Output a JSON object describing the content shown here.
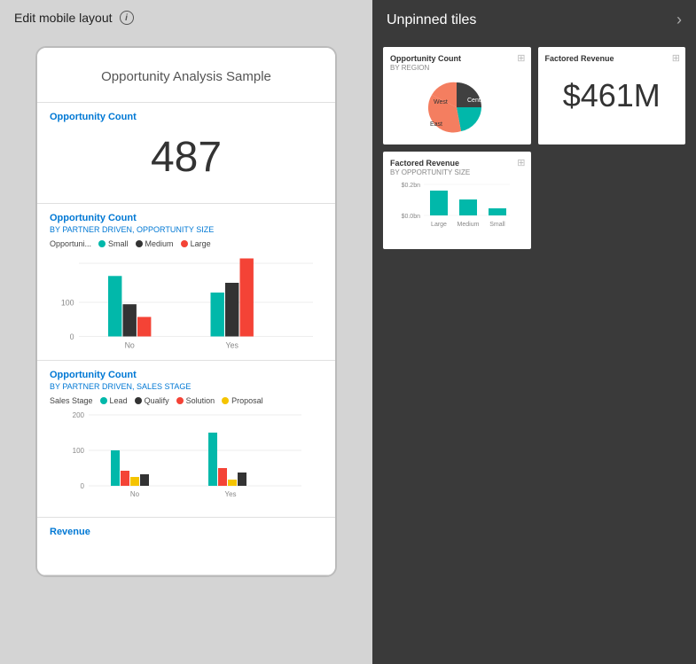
{
  "leftPanel": {
    "headerTitle": "Edit mobile layout",
    "infoIcon": "i",
    "phone": {
      "mainCardTitle": "Opportunity Analysis Sample",
      "cards": [
        {
          "id": "opp-count",
          "label": "Opportunity Count",
          "value": "487"
        },
        {
          "id": "opp-count-partner",
          "label": "Opportunity Count",
          "sublabel": "BY PARTNER DRIVEN, OPPORTUNITY SIZE",
          "legendItems": [
            {
              "label": "Opportuni...",
              "color": "#01b8aa"
            },
            {
              "label": "Small",
              "color": "#01b8aa"
            },
            {
              "label": "Medium",
              "color": "#333"
            },
            {
              "label": "Large",
              "color": "#f44336"
            }
          ],
          "xLabels": [
            "No",
            "Yes"
          ],
          "yLabels": [
            "100",
            "0"
          ],
          "bars": {
            "no": [
              {
                "color": "#01b8aa",
                "heightPct": 62
              },
              {
                "color": "#333333",
                "heightPct": 22
              },
              {
                "color": "#f44336",
                "heightPct": 12
              }
            ],
            "yes": [
              {
                "color": "#01b8aa",
                "heightPct": 45
              },
              {
                "color": "#333333",
                "heightPct": 55
              },
              {
                "color": "#f44336",
                "heightPct": 80
              }
            ]
          }
        },
        {
          "id": "opp-count-sales",
          "label": "Opportunity Count",
          "sublabel": "BY PARTNER DRIVEN, SALES STAGE",
          "legendItems": [
            {
              "label": "Sales Stage",
              "color": null
            },
            {
              "label": "Lead",
              "color": "#01b8aa"
            },
            {
              "label": "Qualify",
              "color": "#333"
            },
            {
              "label": "Solution",
              "color": "#f44336"
            },
            {
              "label": "Proposal",
              "color": "#f5c400"
            }
          ],
          "xLabels": [
            "No",
            "Yes"
          ],
          "yLabels": [
            "200",
            "100",
            "0"
          ]
        },
        {
          "id": "revenue",
          "label": "Revenue"
        }
      ]
    }
  },
  "rightPanel": {
    "headerTitle": "Unpinned tiles",
    "tiles": [
      {
        "id": "opp-count-region",
        "title": "Opportunity Count",
        "subtitle": "BY REGION",
        "type": "pie",
        "pinIcon": "📌",
        "pieLabels": [
          "West",
          "Central",
          "East"
        ]
      },
      {
        "id": "factored-revenue",
        "title": "Factored Revenue",
        "type": "big-number",
        "value": "$461M",
        "pinIcon": "📌"
      },
      {
        "id": "factored-revenue-size",
        "title": "Factored Revenue",
        "subtitle": "BY OPPORTUNITY SIZE",
        "type": "bar",
        "pinIcon": "📌",
        "yLabels": [
          "$0.2bn",
          "$0.0bn"
        ],
        "xLabels": [
          "Large",
          "Medium",
          "Small"
        ]
      }
    ]
  }
}
